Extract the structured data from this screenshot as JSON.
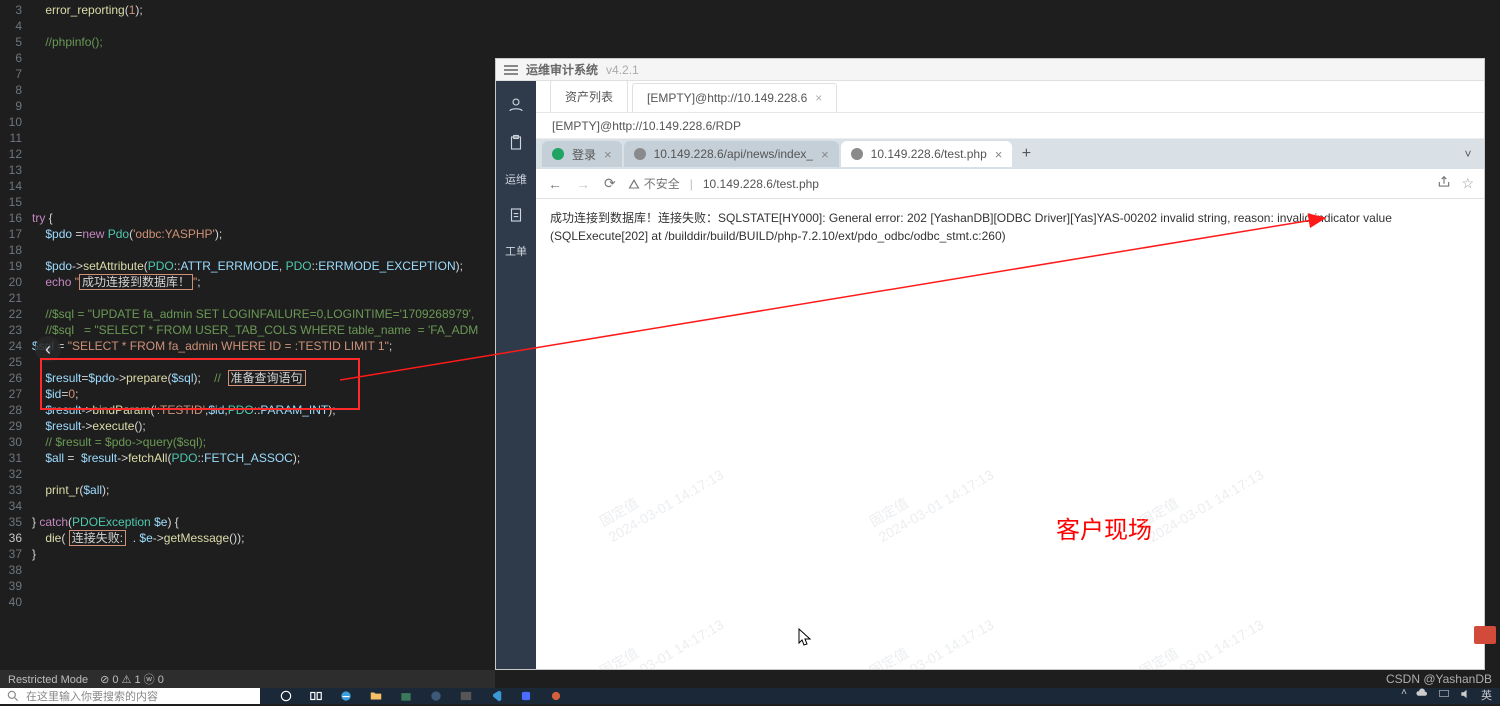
{
  "editor": {
    "line_start": 3,
    "lines": [
      {
        "n": 3,
        "html": "    <span class='f'>error_reporting</span>(<span class='s'>1</span>);"
      },
      {
        "n": 4,
        "html": ""
      },
      {
        "n": 5,
        "html": "    <span class='c'>//phpinfo();</span>"
      },
      {
        "n": 6,
        "html": ""
      },
      {
        "n": 7,
        "html": ""
      },
      {
        "n": 8,
        "html": ""
      },
      {
        "n": 9,
        "html": ""
      },
      {
        "n": 10,
        "html": ""
      },
      {
        "n": 11,
        "html": ""
      },
      {
        "n": 12,
        "html": ""
      },
      {
        "n": 13,
        "html": ""
      },
      {
        "n": 14,
        "html": ""
      },
      {
        "n": 15,
        "html": ""
      },
      {
        "n": 16,
        "html": "<span class='k'>try</span> {"
      },
      {
        "n": 17,
        "html": "    <span class='v'>$pdo</span> =<span class='k'>new</span> <span class='t'>Pdo</span>(<span class='s'>'odbc:YASPHP'</span>);"
      },
      {
        "n": 18,
        "html": ""
      },
      {
        "n": 19,
        "html": "    <span class='v'>$pdo</span>-&gt;<span class='f'>setAttribute</span>(<span class='t'>PDO</span>::<span class='v'>ATTR_ERRMODE</span>, <span class='t'>PDO</span>::<span class='v'>ERRMODE_EXCEPTION</span>);"
      },
      {
        "n": 20,
        "html": "    <span class='k'>echo</span> <span class='s'>\"</span><span class='hl'>成功连接到数据库！</span><span class='s'>\"</span>;"
      },
      {
        "n": 21,
        "html": ""
      },
      {
        "n": 22,
        "html": "    <span class='c'>//$sql = \"UPDATE fa_admin SET LOGINFAILURE=0,LOGINTIME='1709268979',</span>"
      },
      {
        "n": 23,
        "html": "    <span class='c'>//$sql   = \"SELECT * FROM USER_TAB_COLS WHERE table_name  = 'FA_ADM</span>"
      },
      {
        "n": 24,
        "html": "<span class='v'>$sql</span> = <span class='s'>\"SELECT * FROM fa_admin WHERE ID = :TESTID LIMIT 1\"</span>;"
      },
      {
        "n": 25,
        "html": ""
      },
      {
        "n": 26,
        "html": "    <span class='v'>$result</span>=<span class='v'>$pdo</span>-&gt;<span class='f'>prepare</span>(<span class='v'>$sql</span>);    <span class='c'>//</span>  <span class='hl'>准备查询语句</span>"
      },
      {
        "n": 27,
        "html": "    <span class='v'>$id</span>=<span class='s'>0</span>;"
      },
      {
        "n": 28,
        "html": "    <span class='v'>$result</span>-&gt;<span class='f'>bindParam</span>(<span class='s'>':TESTID'</span>,<span class='v'>$id</span>,<span class='t'>PDO</span>::<span class='v'>PARAM_INT</span>);"
      },
      {
        "n": 29,
        "html": "    <span class='v'>$result</span>-&gt;<span class='f'>execute</span>();"
      },
      {
        "n": 30,
        "html": "    <span class='c'>// $result = $pdo-&gt;query($sql);</span>"
      },
      {
        "n": 31,
        "html": "    <span class='v'>$all</span> =  <span class='v'>$result</span>-&gt;<span class='f'>fetchAll</span>(<span class='t'>PDO</span>::<span class='v'>FETCH_ASSOC</span>);"
      },
      {
        "n": 32,
        "html": ""
      },
      {
        "n": 33,
        "html": "    <span class='f'>print_r</span>(<span class='v'>$all</span>);"
      },
      {
        "n": 34,
        "html": ""
      },
      {
        "n": 35,
        "html": "} <span class='k'>catch</span>(<span class='t'>PDOException</span> <span class='v'>$e</span>) {"
      },
      {
        "n": 36,
        "cur": true,
        "html": "    <span class='f'>die</span>( <span class='hl'>连接失败:</span>  . <span class='v'>$e</span>-&gt;<span class='f'>getMessage</span>());"
      },
      {
        "n": 37,
        "html": "}"
      },
      {
        "n": 38,
        "html": ""
      },
      {
        "n": 39,
        "html": ""
      },
      {
        "n": 40,
        "html": ""
      }
    ],
    "status_restricted": "Restricted Mode",
    "status_problems": "⊘ 0 ⚠ 1  ⓦ 0"
  },
  "bastion": {
    "title": "运维审计系统",
    "version": "v4.2.1",
    "tabs": [
      {
        "label": "资产列表"
      },
      {
        "label": "[EMPTY]@http://10.149.228.6"
      }
    ],
    "crumb": "[EMPTY]@http://10.149.228.6/RDP",
    "side": [
      {
        "name": "user-icon"
      },
      {
        "name": "clipboard-icon"
      },
      {
        "name": "ops-label",
        "text": "运维"
      },
      {
        "name": "paste-icon"
      },
      {
        "name": "workorder-label",
        "text": "工单"
      }
    ]
  },
  "chrome": {
    "tabs": [
      {
        "label": "登录",
        "fav": "#1fa463"
      },
      {
        "label": "10.149.228.6/api/news/index_",
        "fav": "#8a8a8a"
      },
      {
        "label": "10.149.228.6/test.php",
        "fav": "#8a8a8a",
        "active": true
      }
    ],
    "nav": {
      "back": "←",
      "fwd": "→",
      "reload": "⟳"
    },
    "insecure": "不安全",
    "url": "10.149.228.6/test.php",
    "share_icon": "share-icon",
    "star_icon": "star-icon",
    "page_text": "成功连接到数据库！连接失败：SQLSTATE[HY000]: General error: 202 [YashanDB][ODBC Driver][Yas]YAS-00202 invalid string, reason: invalid indicator value (SQLExecute[202] at /builddir/build/BUILD/php-7.2.10/ext/pdo_odbc/odbc_stmt.c:260)"
  },
  "overlay": {
    "big_red": "客户现场",
    "csdn": "CSDN @YashanDB"
  },
  "taskbar": {
    "search_placeholder": "在这里输入你要搜索的内容"
  },
  "watermark": {
    "line1": "固定值",
    "line2": "2024-03-01 14:17:13"
  }
}
